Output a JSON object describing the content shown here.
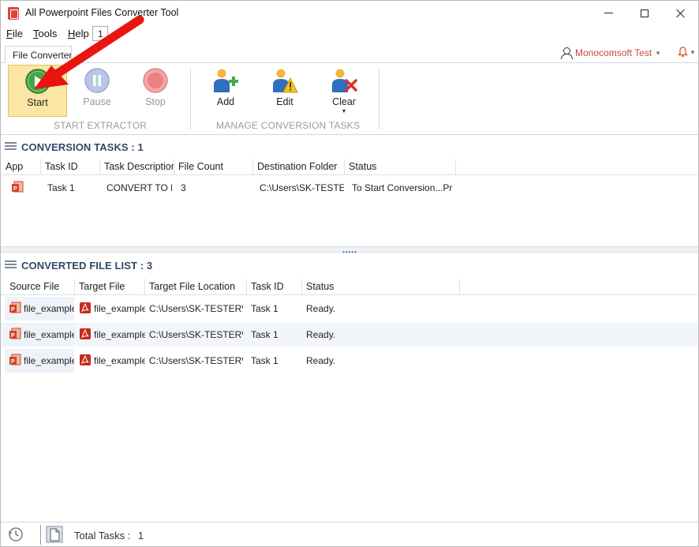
{
  "window": {
    "title": "All Powerpoint Files Converter Tool"
  },
  "menu": {
    "file": "File",
    "tools": "Tools",
    "help": "Help",
    "badge": "1"
  },
  "ribbon": {
    "tab_label": "File Converter",
    "user_name": "Monocomsoft Test",
    "buttons": {
      "start": "Start",
      "pause": "Pause",
      "stop": "Stop",
      "add": "Add",
      "edit": "Edit",
      "clear": "Clear"
    },
    "groups": {
      "extractor": "START EXTRACTOR",
      "manage": "MANAGE CONVERSION TASKS"
    }
  },
  "tasks": {
    "header": "CONVERSION TASKS : 1",
    "columns": [
      "App",
      "Task ID",
      "Task Description",
      "File Count",
      "Destination Folder",
      "Status"
    ],
    "rows": [
      {
        "app_icon": "powerpoint-icon",
        "task_id": "Task 1",
        "description": "CONVERT TO PI",
        "file_count": "3",
        "destination": "C:\\Users\\SK-TESTER",
        "status": "To Start Conversion...Pre"
      }
    ]
  },
  "files": {
    "header": "CONVERTED FILE LIST : 3",
    "columns": [
      "Source File",
      "Target File",
      "Target File Location",
      "Task ID",
      "Status"
    ],
    "rows": [
      {
        "source": "file_example",
        "target": "file_example",
        "location": "C:\\Users\\SK-TESTER\\D",
        "task_id": "Task 1",
        "status": "Ready."
      },
      {
        "source": "file_example",
        "target": "file_example",
        "location": "C:\\Users\\SK-TESTER\\D",
        "task_id": "Task 1",
        "status": "Ready."
      },
      {
        "source": "file_example",
        "target": "file_example",
        "location": "C:\\Users\\SK-TESTER\\D",
        "task_id": "Task 1",
        "status": "Ready."
      }
    ]
  },
  "statusbar": {
    "total_label": "Total Tasks :",
    "total_value": "1"
  },
  "colors": {
    "accent": "#2e4a66",
    "start_highlight": "#fbe6a3",
    "arrow": "#e8150f",
    "user_text": "#c24a3a"
  }
}
